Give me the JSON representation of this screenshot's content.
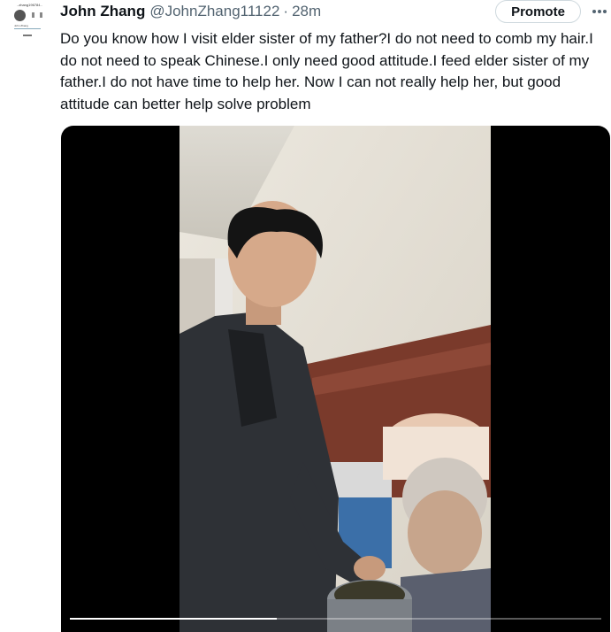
{
  "avatar": {
    "tiny_text": "..zhang196784..",
    "tiny_name": "John Zhang",
    "icon": "profile-screenshot-avatar"
  },
  "tweet": {
    "author_name": "John Zhang",
    "handle": "@JohnZhang11122",
    "separator": "·",
    "time": "28m",
    "text": "Do you know how I visit elder sister of my father?I do not need to comb my hair.I do not need to speak Chinese.I only need good attitude.I feed elder sister of my father.I do not have time to help her. Now I can not really help her, but good attitude can better help solve problem"
  },
  "actions": {
    "promote_label": "Promote",
    "more_icon": "more-horizontal-icon"
  },
  "video": {
    "progress": 0.39,
    "colors": {
      "background": "#000000",
      "progress": "#ffffff"
    }
  }
}
